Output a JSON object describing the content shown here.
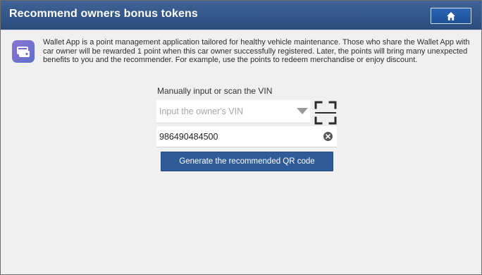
{
  "header": {
    "title": "Recommend owners bonus tokens",
    "home_icon": "home-icon"
  },
  "app": {
    "icon": "wallet-app-icon",
    "description": "Wallet App is a point management application tailored for healthy vehicle maintenance. Those who share the Wallet App with car owner will be rewarded 1 point when this car owner successfully registered. Later, the points will bring many unexpected benefits to you and the recommender. For example, use the points to redeem merchandise or enjoy discount."
  },
  "vin": {
    "label": "Manually input or scan the VIN",
    "select_placeholder": "Input the owner's VIN",
    "scan_icon": "scan-icon",
    "input_value": "986490484500",
    "clear_icon": "clear-icon"
  },
  "actions": {
    "generate_label": "Generate the recommended QR code"
  },
  "colors": {
    "header_bg": "#2b4c7d",
    "button_bg": "#2f5c99",
    "content_bg": "#f0f0f0",
    "app_icon_gradient": [
      "#8c74d4",
      "#5b6fc9"
    ]
  }
}
